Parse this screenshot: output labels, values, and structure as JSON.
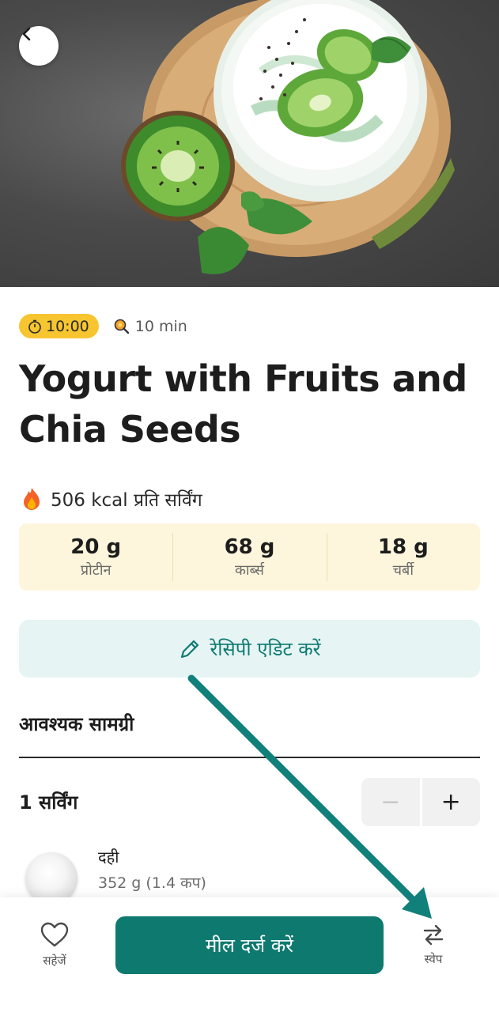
{
  "header": {
    "back_icon": "chevron-left-icon"
  },
  "recipe": {
    "time_badge": "10:00",
    "duration": "10 min",
    "title": "Yogurt with Fruits and Chia Seeds",
    "kcal": "506 kcal प्रति सर्विंग",
    "macros": [
      {
        "value": "20 g",
        "label": "प्रोटीन"
      },
      {
        "value": "68 g",
        "label": "कार्ब्स"
      },
      {
        "value": "18 g",
        "label": "चर्बी"
      }
    ],
    "edit_label": "रेसिपी एडिट करें"
  },
  "ingredients": {
    "section_title": "आवश्यक सामग्री",
    "serving_label": "1 सर्विंग",
    "minus": "−",
    "plus": "+",
    "items": [
      {
        "name": "दही",
        "qty": "352 g (1.4 कप)"
      }
    ]
  },
  "bottom_bar": {
    "save_label": "सहेजें",
    "log_label": "मील दर्ज करें",
    "swap_label": "स्वेप"
  },
  "colors": {
    "accent": "#0e7a6f",
    "badge": "#f6c530",
    "macro_bg": "#fdf6dc",
    "edit_bg": "#e6f4f3"
  }
}
